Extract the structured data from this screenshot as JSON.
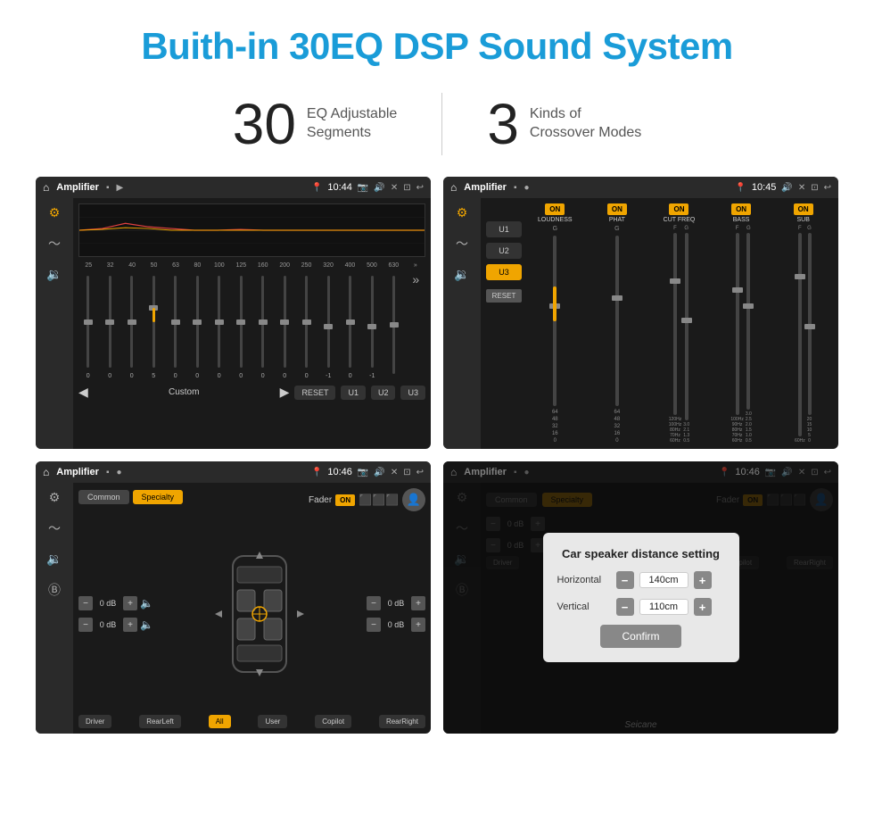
{
  "header": {
    "title": "Buith-in 30EQ DSP Sound System"
  },
  "stats": [
    {
      "number": "30",
      "label": "EQ Adjustable\nSegments"
    },
    {
      "number": "3",
      "label": "Kinds of\nCrossover Modes"
    }
  ],
  "screen1": {
    "title": "Amplifier",
    "time": "10:44",
    "freqs": [
      "25",
      "32",
      "40",
      "50",
      "63",
      "80",
      "100",
      "125",
      "160",
      "200",
      "250",
      "320",
      "400",
      "500",
      "630"
    ],
    "vals": [
      "0",
      "0",
      "0",
      "5",
      "0",
      "0",
      "0",
      "0",
      "0",
      "0",
      "0",
      "-1",
      "0",
      "-1",
      ""
    ],
    "buttons": [
      "RESET",
      "U1",
      "U2",
      "U3"
    ],
    "preset": "Custom"
  },
  "screen2": {
    "title": "Amplifier",
    "time": "10:45",
    "bands": [
      "LOUDNESS",
      "PHAT",
      "CUT FREQ",
      "BASS",
      "SUB"
    ],
    "presets": [
      "U1",
      "U2",
      "U3"
    ],
    "activePreset": "U3",
    "resetLabel": "RESET"
  },
  "screen3": {
    "title": "Amplifier",
    "time": "10:46",
    "tabs": [
      "Common",
      "Specialty"
    ],
    "faderLabel": "Fader",
    "faderOn": "ON",
    "levels": [
      {
        "val": "0 dB"
      },
      {
        "val": "0 dB"
      },
      {
        "val": "0 dB"
      },
      {
        "val": "0 dB"
      }
    ],
    "buttons": [
      "Driver",
      "RearLeft",
      "All",
      "User",
      "Copilot",
      "RearRight"
    ]
  },
  "screen4": {
    "title": "Amplifier",
    "time": "10:46",
    "dialog": {
      "title": "Car speaker distance setting",
      "horizontal_label": "Horizontal",
      "horizontal_value": "140cm",
      "vertical_label": "Vertical",
      "vertical_value": "110cm",
      "confirm_label": "Confirm"
    }
  },
  "watermark": "Seicane"
}
